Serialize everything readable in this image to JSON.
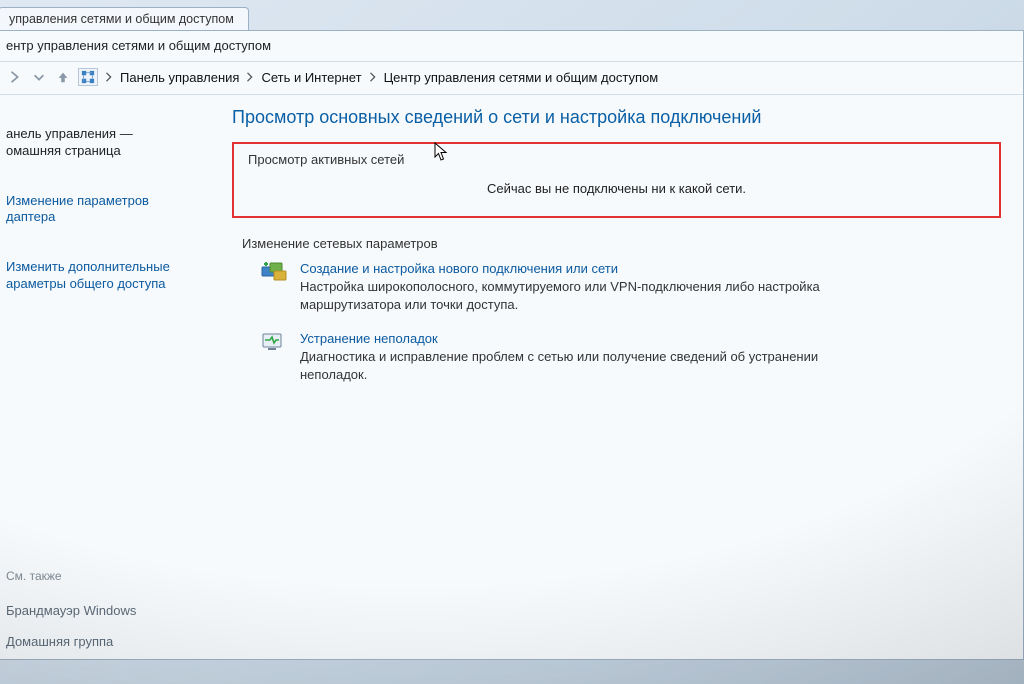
{
  "tab_title": "управления сетями и общим доступом",
  "window_title": "ентр управления сетями и общим доступом",
  "breadcrumb": {
    "items": [
      "Панель управления",
      "Сеть и Интернет",
      "Центр управления сетями и общим доступом"
    ]
  },
  "sidebar": {
    "home": "анель управления —\nомашняя страница",
    "links": [
      "Изменение параметров\nдаптера",
      "Изменить дополнительные\nараметры общего доступа"
    ],
    "see_also_label": "См. также",
    "footer_links": [
      "Брандмауэр Windows",
      "Домашняя группа"
    ]
  },
  "content": {
    "page_heading": "Просмотр основных сведений о сети и настройка подключений",
    "active_nets_caption": "Просмотр активных сетей",
    "no_network_text": "Сейчас вы не подключены ни к какой сети.",
    "change_settings_caption": "Изменение сетевых параметров",
    "options": [
      {
        "title": "Создание и настройка нового подключения или сети",
        "desc": "Настройка широкополосного, коммутируемого или VPN-подключения либо настройка маршрутизатора или точки доступа."
      },
      {
        "title": "Устранение неполадок",
        "desc": "Диагностика и исправление проблем с сетью или получение сведений об устранении неполадок."
      }
    ]
  }
}
